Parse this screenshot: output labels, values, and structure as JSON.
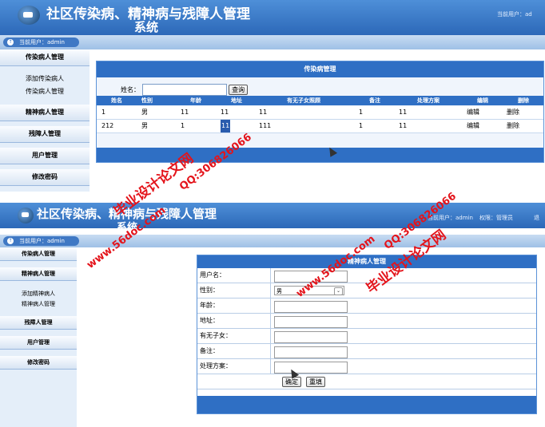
{
  "screen1": {
    "title_line1": "社区传染病、精神病与残障人管理",
    "title_line2": "系统",
    "top_user": "当前用户：ad",
    "userbar": "当前用户：admin",
    "menu": {
      "infectious": "传染病人管理",
      "infectious_items": [
        "添加传染病人",
        "传染病人管理"
      ],
      "mental": "精神病人管理",
      "disabled": "残障人管理",
      "users": "用户管理",
      "password": "修改密码"
    },
    "panel_title": "传染病管理",
    "search_label": "姓名：",
    "search_value": "",
    "search_button": "查询",
    "columns": [
      "姓名",
      "性别",
      "年龄",
      "地址",
      "有无子女照顾",
      "备注",
      "处理方案",
      "编辑",
      "删除"
    ],
    "rows": [
      [
        "1",
        "男",
        "11",
        "11",
        "11",
        "1",
        "11",
        "编辑",
        "删除"
      ],
      [
        "212",
        "男",
        "1",
        "11",
        "111",
        "1",
        "11",
        "编辑",
        "删除"
      ]
    ]
  },
  "screen2": {
    "title_line1": "社区传染病、精神病与残障人管理",
    "title_line2": "系统",
    "top_user": "当前用户：admin",
    "top_role": "权限：管理员",
    "top_more": "退",
    "userbar": "当前用户：admin",
    "menu": {
      "infectious": "传染病人管理",
      "mental": "精神病人管理",
      "mental_items": [
        "添加精神病人",
        "精神病人管理"
      ],
      "disabled": "残障人管理",
      "users": "用户管理",
      "password": "修改密码"
    },
    "form_title": "精神病人管理",
    "fields": {
      "name": "用户名：",
      "gender": "性别：",
      "gender_value": "男",
      "age": "年龄：",
      "address": "地址：",
      "children": "有无子女：",
      "remark": "备注：",
      "plan": "处理方案："
    },
    "confirm_button": "确定",
    "reset_button": "重填"
  },
  "watermarks": {
    "site": "www.56doc.com",
    "brand": "毕业设计论文网",
    "qq": "QQ:306826066"
  },
  "colors": {
    "header_blue": "#2f6fc4",
    "sidebar_bg": "#e4eef9",
    "watermark_red": "#e4141b"
  }
}
